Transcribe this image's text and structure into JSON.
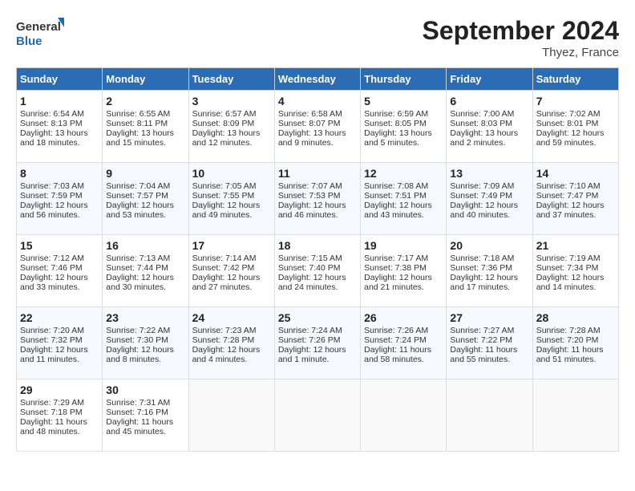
{
  "logo": {
    "line1": "General",
    "line2": "Blue"
  },
  "title": "September 2024",
  "location": "Thyez, France",
  "days_header": [
    "Sunday",
    "Monday",
    "Tuesday",
    "Wednesday",
    "Thursday",
    "Friday",
    "Saturday"
  ],
  "weeks": [
    [
      {
        "day": "1",
        "sunrise": "6:54 AM",
        "sunset": "8:13 PM",
        "daylight": "13 hours and 18 minutes."
      },
      {
        "day": "2",
        "sunrise": "6:55 AM",
        "sunset": "8:11 PM",
        "daylight": "13 hours and 15 minutes."
      },
      {
        "day": "3",
        "sunrise": "6:57 AM",
        "sunset": "8:09 PM",
        "daylight": "13 hours and 12 minutes."
      },
      {
        "day": "4",
        "sunrise": "6:58 AM",
        "sunset": "8:07 PM",
        "daylight": "13 hours and 9 minutes."
      },
      {
        "day": "5",
        "sunrise": "6:59 AM",
        "sunset": "8:05 PM",
        "daylight": "13 hours and 5 minutes."
      },
      {
        "day": "6",
        "sunrise": "7:00 AM",
        "sunset": "8:03 PM",
        "daylight": "13 hours and 2 minutes."
      },
      {
        "day": "7",
        "sunrise": "7:02 AM",
        "sunset": "8:01 PM",
        "daylight": "12 hours and 59 minutes."
      }
    ],
    [
      {
        "day": "8",
        "sunrise": "7:03 AM",
        "sunset": "7:59 PM",
        "daylight": "12 hours and 56 minutes."
      },
      {
        "day": "9",
        "sunrise": "7:04 AM",
        "sunset": "7:57 PM",
        "daylight": "12 hours and 53 minutes."
      },
      {
        "day": "10",
        "sunrise": "7:05 AM",
        "sunset": "7:55 PM",
        "daylight": "12 hours and 49 minutes."
      },
      {
        "day": "11",
        "sunrise": "7:07 AM",
        "sunset": "7:53 PM",
        "daylight": "12 hours and 46 minutes."
      },
      {
        "day": "12",
        "sunrise": "7:08 AM",
        "sunset": "7:51 PM",
        "daylight": "12 hours and 43 minutes."
      },
      {
        "day": "13",
        "sunrise": "7:09 AM",
        "sunset": "7:49 PM",
        "daylight": "12 hours and 40 minutes."
      },
      {
        "day": "14",
        "sunrise": "7:10 AM",
        "sunset": "7:47 PM",
        "daylight": "12 hours and 37 minutes."
      }
    ],
    [
      {
        "day": "15",
        "sunrise": "7:12 AM",
        "sunset": "7:46 PM",
        "daylight": "12 hours and 33 minutes."
      },
      {
        "day": "16",
        "sunrise": "7:13 AM",
        "sunset": "7:44 PM",
        "daylight": "12 hours and 30 minutes."
      },
      {
        "day": "17",
        "sunrise": "7:14 AM",
        "sunset": "7:42 PM",
        "daylight": "12 hours and 27 minutes."
      },
      {
        "day": "18",
        "sunrise": "7:15 AM",
        "sunset": "7:40 PM",
        "daylight": "12 hours and 24 minutes."
      },
      {
        "day": "19",
        "sunrise": "7:17 AM",
        "sunset": "7:38 PM",
        "daylight": "12 hours and 21 minutes."
      },
      {
        "day": "20",
        "sunrise": "7:18 AM",
        "sunset": "7:36 PM",
        "daylight": "12 hours and 17 minutes."
      },
      {
        "day": "21",
        "sunrise": "7:19 AM",
        "sunset": "7:34 PM",
        "daylight": "12 hours and 14 minutes."
      }
    ],
    [
      {
        "day": "22",
        "sunrise": "7:20 AM",
        "sunset": "7:32 PM",
        "daylight": "12 hours and 11 minutes."
      },
      {
        "day": "23",
        "sunrise": "7:22 AM",
        "sunset": "7:30 PM",
        "daylight": "12 hours and 8 minutes."
      },
      {
        "day": "24",
        "sunrise": "7:23 AM",
        "sunset": "7:28 PM",
        "daylight": "12 hours and 4 minutes."
      },
      {
        "day": "25",
        "sunrise": "7:24 AM",
        "sunset": "7:26 PM",
        "daylight": "12 hours and 1 minute."
      },
      {
        "day": "26",
        "sunrise": "7:26 AM",
        "sunset": "7:24 PM",
        "daylight": "11 hours and 58 minutes."
      },
      {
        "day": "27",
        "sunrise": "7:27 AM",
        "sunset": "7:22 PM",
        "daylight": "11 hours and 55 minutes."
      },
      {
        "day": "28",
        "sunrise": "7:28 AM",
        "sunset": "7:20 PM",
        "daylight": "11 hours and 51 minutes."
      }
    ],
    [
      {
        "day": "29",
        "sunrise": "7:29 AM",
        "sunset": "7:18 PM",
        "daylight": "11 hours and 48 minutes."
      },
      {
        "day": "30",
        "sunrise": "7:31 AM",
        "sunset": "7:16 PM",
        "daylight": "11 hours and 45 minutes."
      },
      null,
      null,
      null,
      null,
      null
    ]
  ],
  "labels": {
    "sunrise": "Sunrise:",
    "sunset": "Sunset:",
    "daylight": "Daylight:"
  }
}
